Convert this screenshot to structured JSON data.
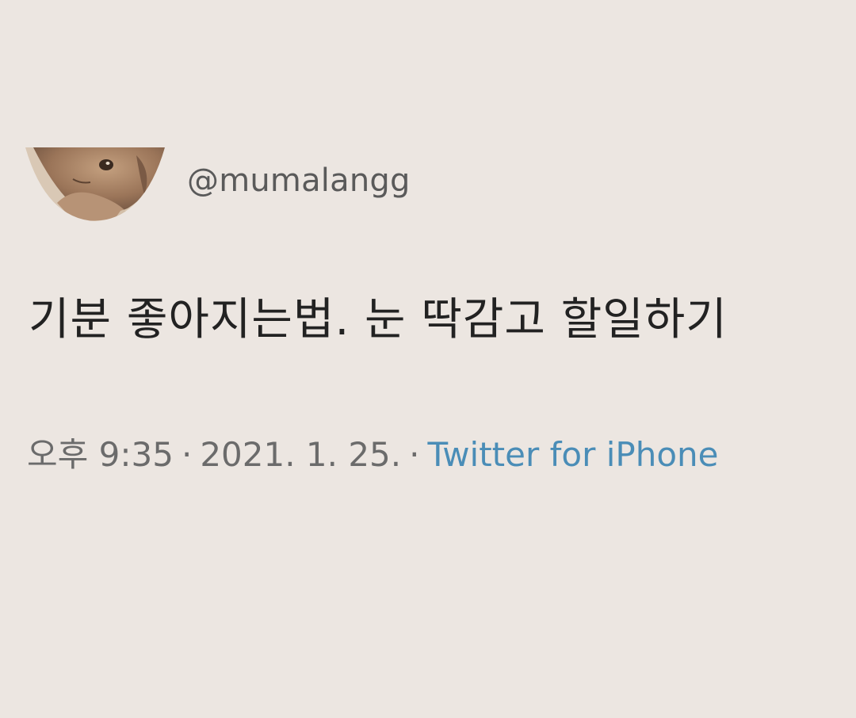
{
  "tweet": {
    "avatar_icon": "rabbit-avatar-icon",
    "handle": "@mumalangg",
    "text": "기분 좋아지는법. 눈 딱감고 할일하기",
    "time": "오후 9:35",
    "separator": "·",
    "date": "2021. 1. 25.",
    "source": "Twitter for iPhone",
    "colors": {
      "background": "#ece6e1",
      "text": "#222222",
      "meta": "#6b6b6b",
      "link": "#4a8db7"
    }
  }
}
